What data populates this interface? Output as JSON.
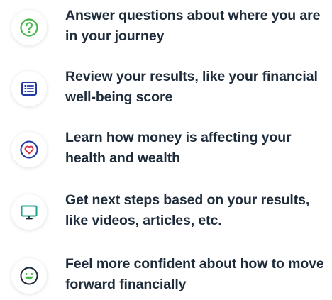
{
  "steps": [
    {
      "icon": "question-circle-icon",
      "text": "Answer questions about where you are in your journey",
      "color": "#47b64b"
    },
    {
      "icon": "list-icon",
      "text": "Review your results, like your financial well-being score",
      "color": "#1f3aa3"
    },
    {
      "icon": "heart-icon",
      "text": "Learn how money is affecting your health and wealth",
      "color": "#d8334a"
    },
    {
      "icon": "monitor-icon",
      "text": "Get next steps based on your results, like videos, articles, etc.",
      "color": "#19a38a"
    },
    {
      "icon": "smiley-icon",
      "text": "Feel more confident about how to move forward financially",
      "color": "#47b64b"
    }
  ],
  "text_color": "#1d2b3a"
}
